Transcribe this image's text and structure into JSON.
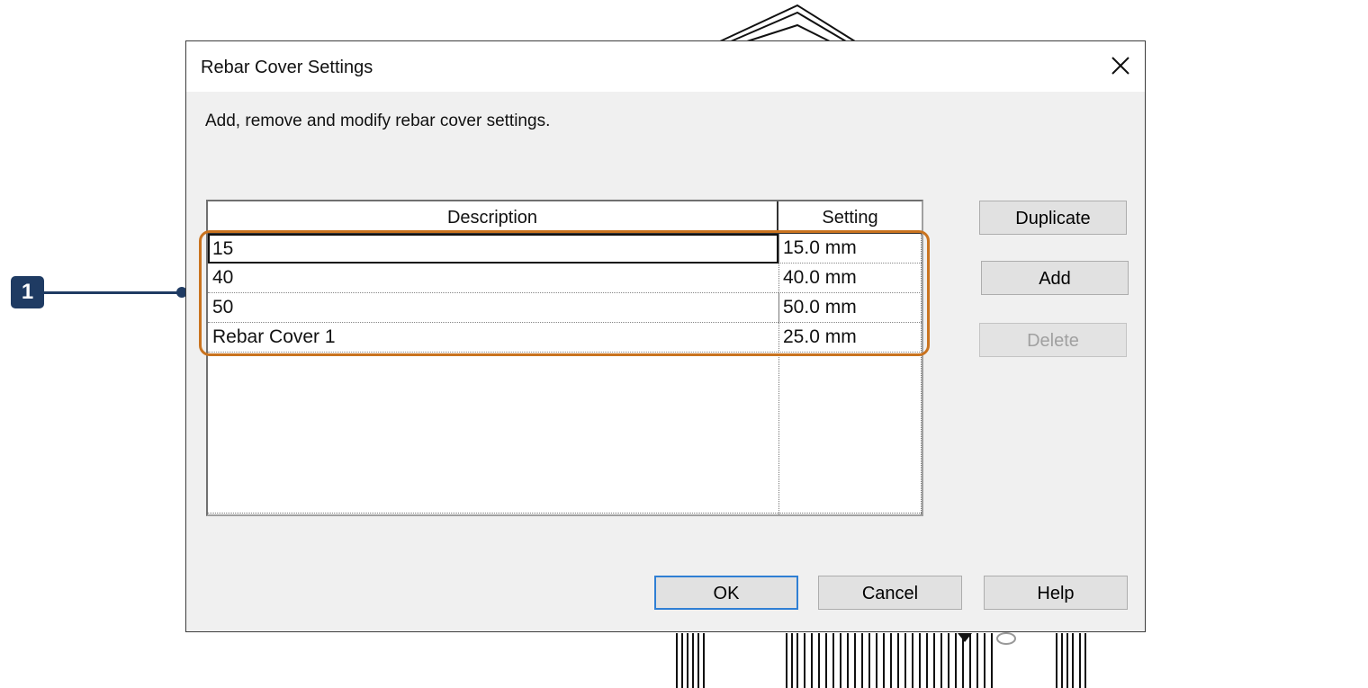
{
  "dialog": {
    "title": "Rebar Cover Settings",
    "instructions": "Add, remove and modify rebar cover settings."
  },
  "table": {
    "columns": [
      "Description",
      "Setting"
    ],
    "rows": [
      {
        "description": "15",
        "setting": "15.0 mm"
      },
      {
        "description": "40",
        "setting": "40.0 mm"
      },
      {
        "description": "50",
        "setting": "50.0 mm"
      },
      {
        "description": "Rebar Cover 1",
        "setting": "25.0 mm"
      }
    ],
    "selected_row": 0
  },
  "side_buttons": {
    "duplicate": "Duplicate",
    "add": "Add",
    "delete": "Delete"
  },
  "footer_buttons": {
    "ok": "OK",
    "cancel": "Cancel",
    "help": "Help"
  },
  "callout": {
    "number": "1"
  },
  "colors": {
    "callout": "#1f3b63",
    "highlight": "#c9731f",
    "default_button_border": "#2f7fd4"
  }
}
